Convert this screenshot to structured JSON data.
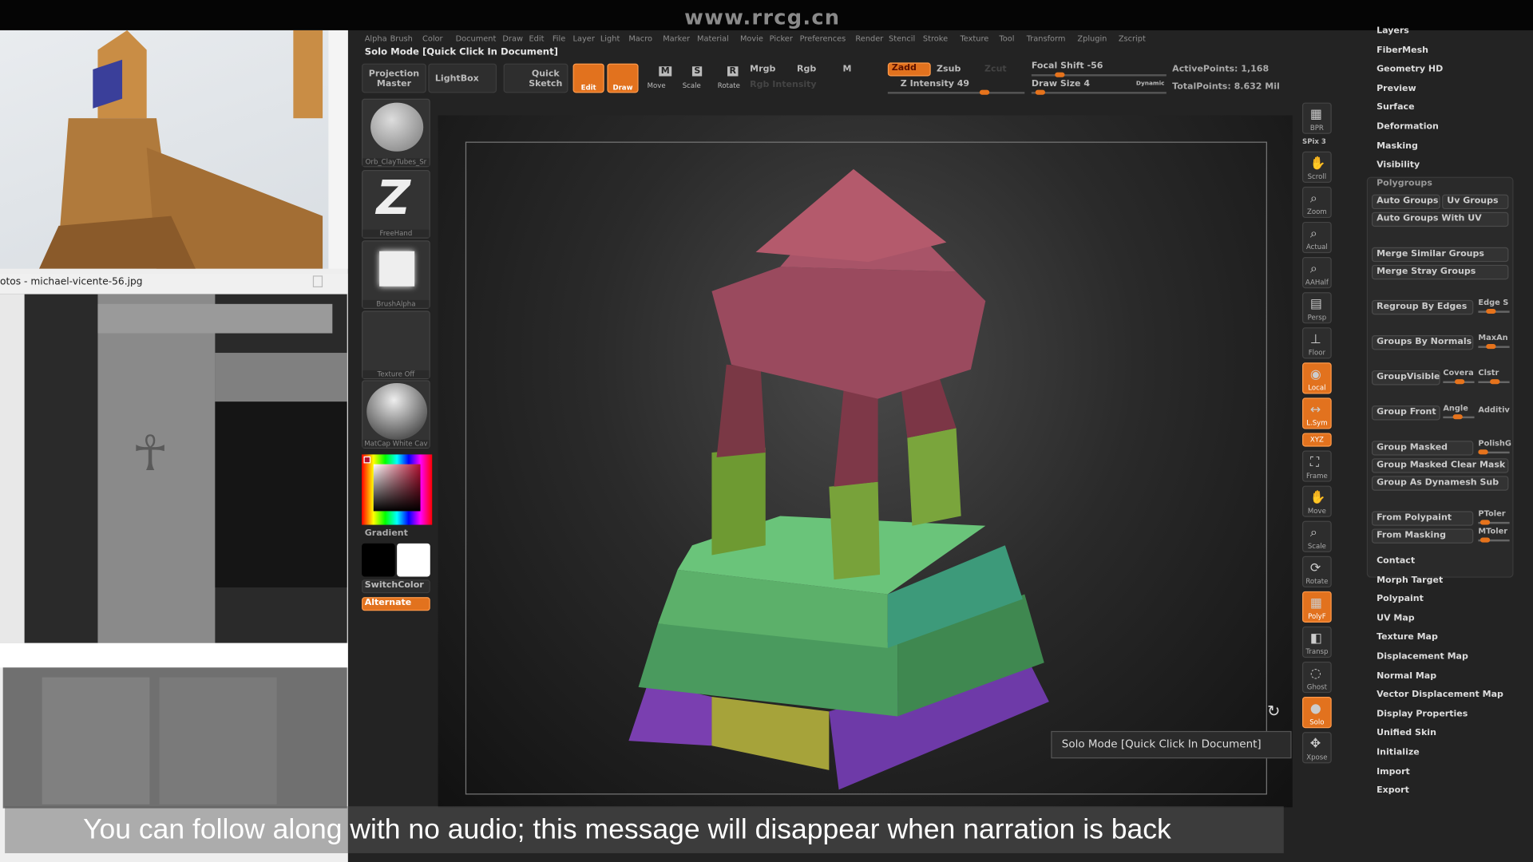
{
  "watermark": "www.rrcg.cn",
  "reference_window": {
    "title": "otos - michael-vicente-56.jpg"
  },
  "menu": [
    "Alpha",
    "Brush",
    "Color",
    "Document",
    "Draw",
    "Edit",
    "File",
    "Layer",
    "Light",
    "Macro",
    "Marker",
    "Material",
    "Movie",
    "Picker",
    "Preferences",
    "Render",
    "Stencil",
    "Stroke",
    "Texture",
    "Tool",
    "Transform",
    "Zplugin",
    "Zscript"
  ],
  "title": "Solo Mode [Quick Click In Document]",
  "toolbar": {
    "projection_master": "Projection Master",
    "lightbox": "LightBox",
    "quick_sketch": "Quick Sketch",
    "edit": "Edit",
    "draw": "Draw",
    "move": "Move",
    "scale": "Scale",
    "rotate": "Rotate",
    "mrgb": "Mrgb",
    "rgb": "Rgb",
    "m": "M",
    "rgb_intensity": "Rgb Intensity",
    "zadd": "Zadd",
    "zsub": "Zsub",
    "zcut": "Zcut",
    "z_intensity": "Z Intensity 49",
    "focal_shift": "Focal Shift -56",
    "draw_size": "Draw Size 4",
    "dynamic": "Dynamic",
    "active_points": "ActivePoints: 1,168",
    "total_points": "TotalPoints: 8.632 Mil",
    "z_intensity_value": 49,
    "focal_shift_value": -56,
    "draw_size_value": 4
  },
  "left_shelf": {
    "brush": "Orb_ClayTubes_Sr",
    "stroke": "FreeHand",
    "alpha": "BrushAlpha",
    "texture": "Texture Off",
    "material": "MatCap White Cav",
    "gradient": "Gradient",
    "switch_color": "SwitchColor",
    "alternate": "Alternate",
    "main_color": "#b01030"
  },
  "right_shelf": [
    {
      "label": "BPR",
      "icon": "bpr-icon",
      "active": false
    },
    {
      "label": "SPix 3",
      "icon": "spix-slider",
      "active": false
    },
    {
      "label": "Scroll",
      "icon": "hand-icon",
      "active": false
    },
    {
      "label": "Zoom",
      "icon": "zoom-icon",
      "active": false
    },
    {
      "label": "Actual",
      "icon": "magnifier-icon",
      "active": false
    },
    {
      "label": "AAHalf",
      "icon": "magnifier-icon",
      "active": false
    },
    {
      "label": "Persp",
      "icon": "grid-icon",
      "active": false
    },
    {
      "label": "Floor",
      "icon": "floor-icon",
      "active": false
    },
    {
      "label": "Local",
      "icon": "local-icon",
      "active": true
    },
    {
      "label": "L.Sym",
      "icon": "symmetry-icon",
      "active": true
    },
    {
      "label": "XYZ",
      "icon": "rotate-axis-icon",
      "active": true
    },
    {
      "label": "Frame",
      "icon": "frame-icon",
      "active": false
    },
    {
      "label": "Move",
      "icon": "hand-icon",
      "active": false
    },
    {
      "label": "Scale",
      "icon": "zoom-icon",
      "active": false
    },
    {
      "label": "Rotate",
      "icon": "rotate-icon",
      "active": false
    },
    {
      "label": "PolyF",
      "icon": "polyframe-icon",
      "active": true
    },
    {
      "label": "Transp",
      "icon": "transparency-icon",
      "active": false
    },
    {
      "label": "Ghost",
      "icon": "ghost-icon",
      "active": false
    },
    {
      "label": "Solo",
      "icon": "solo-icon",
      "active": true
    },
    {
      "label": "Xpose",
      "icon": "xpose-icon",
      "active": false
    }
  ],
  "palette_top": [
    "Layers",
    "FiberMesh",
    "Geometry HD",
    "Preview",
    "Surface",
    "Deformation",
    "Masking",
    "Visibility"
  ],
  "polygroups": {
    "header": "Polygroups",
    "auto_groups": "Auto Groups",
    "uv_groups": "Uv Groups",
    "auto_groups_uv": "Auto Groups With UV",
    "merge_similar": "Merge Similar Groups",
    "merge_stray": "Merge Stray Groups",
    "regroup_edges": "Regroup By Edges",
    "edge_s": "Edge S",
    "groups_normals": "Groups By Normals",
    "maxang": "MaxAn",
    "group_visible": "GroupVisible",
    "covera": "Covera",
    "clstr": "Clstr",
    "group_front": "Group Front",
    "angle": "Angle",
    "additiv": "Additiv",
    "group_masked": "Group Masked",
    "polishg": "PolishG",
    "group_masked_clear": "Group Masked Clear Mask",
    "group_dynamesh": "Group As Dynamesh Sub",
    "from_polypaint": "From Polypaint",
    "ptoler": "PToler",
    "from_masking": "From Masking",
    "mtoler": "MToler"
  },
  "palette_bottom": [
    "Contact",
    "Morph Target",
    "Polypaint",
    "UV Map",
    "Texture Map",
    "Displacement Map",
    "Normal Map",
    "Vector Displacement Map",
    "Display Properties",
    "Unified Skin",
    "Initialize",
    "Import",
    "Export"
  ],
  "tooltip": "Solo Mode [Quick Click In Document]",
  "subtitle": "You can follow along with no audio; this message will disappear when narration is back",
  "colors": {
    "accent": "#e2721e",
    "background": "#232323"
  }
}
